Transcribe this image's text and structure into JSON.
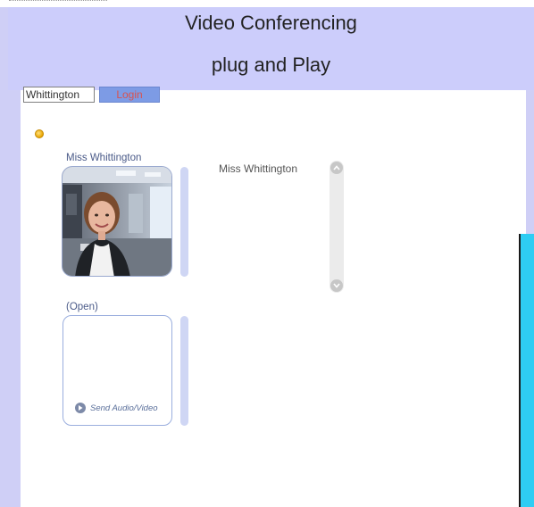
{
  "header": {
    "title_line1": "Video Conferencing",
    "title_line2": "plug and Play"
  },
  "login": {
    "username_value": "Whittington",
    "login_label": "Login"
  },
  "slots": [
    {
      "name": "Miss Whittington"
    },
    {
      "name": "(Open)",
      "send_label": "Send Audio/Video"
    }
  ],
  "participants": {
    "items": [
      "Miss Whittington"
    ]
  },
  "colors": {
    "header_bg": "#cccdfb",
    "side_rail": "#cfcff6",
    "login_button": "#7d9be5",
    "login_text": "#d9534f",
    "cyan_panel": "#2ecdf3",
    "status_dot": "#e9a400"
  },
  "icons": {
    "status": "status-dot-icon",
    "send": "play-circle-icon",
    "scroll_up": "chevron-up-icon",
    "scroll_down": "chevron-down-icon"
  }
}
